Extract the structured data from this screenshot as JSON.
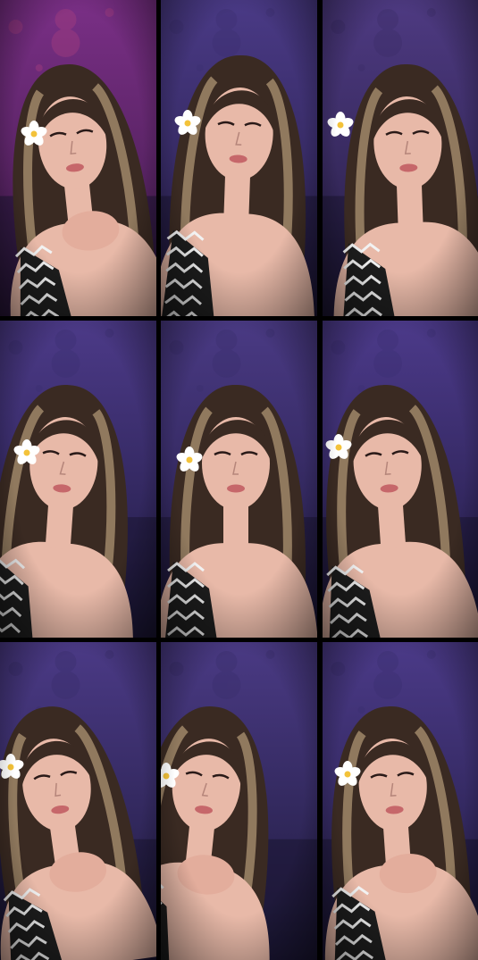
{
  "grid": {
    "rows": 3,
    "cols": 3,
    "cells": [
      {
        "id": "r1c1",
        "bg_top": "#7a2f86",
        "bg_bottom": "#3d1a48",
        "accent": "#b2427f"
      },
      {
        "id": "r1c2",
        "bg_top": "#4a3a86",
        "bg_bottom": "#241c44",
        "accent": "#3c2f70"
      },
      {
        "id": "r1c3",
        "bg_top": "#4e3a82",
        "bg_bottom": "#241c40",
        "accent": "#3a2c66"
      },
      {
        "id": "r2c1",
        "bg_top": "#4c3a88",
        "bg_bottom": "#1f1a40",
        "accent": "#3a2f70"
      },
      {
        "id": "r2c2",
        "bg_top": "#4a3a84",
        "bg_bottom": "#201a40",
        "accent": "#392e6c"
      },
      {
        "id": "r2c3",
        "bg_top": "#4c3a8a",
        "bg_bottom": "#201a40",
        "accent": "#3b2f72"
      },
      {
        "id": "r3c1",
        "bg_top": "#4b3a86",
        "bg_bottom": "#1e1a3c",
        "accent": "#382d6a"
      },
      {
        "id": "r3c2",
        "bg_top": "#4a3a84",
        "bg_bottom": "#1e1a3c",
        "accent": "#382d6a"
      },
      {
        "id": "r3c3",
        "bg_top": "#4b3a88",
        "bg_bottom": "#1f1a3e",
        "accent": "#392e6e"
      }
    ]
  },
  "colors": {
    "gutter": "#000000",
    "skin": "#e8b9a8",
    "hair": "#3a2a22",
    "hair_highlight": "#b59b78",
    "flower_petal": "#ffffff",
    "flower_center": "#f3c23a",
    "top_pattern_dark": "#1d1d1d",
    "top_pattern_light": "#f2f2f2"
  }
}
